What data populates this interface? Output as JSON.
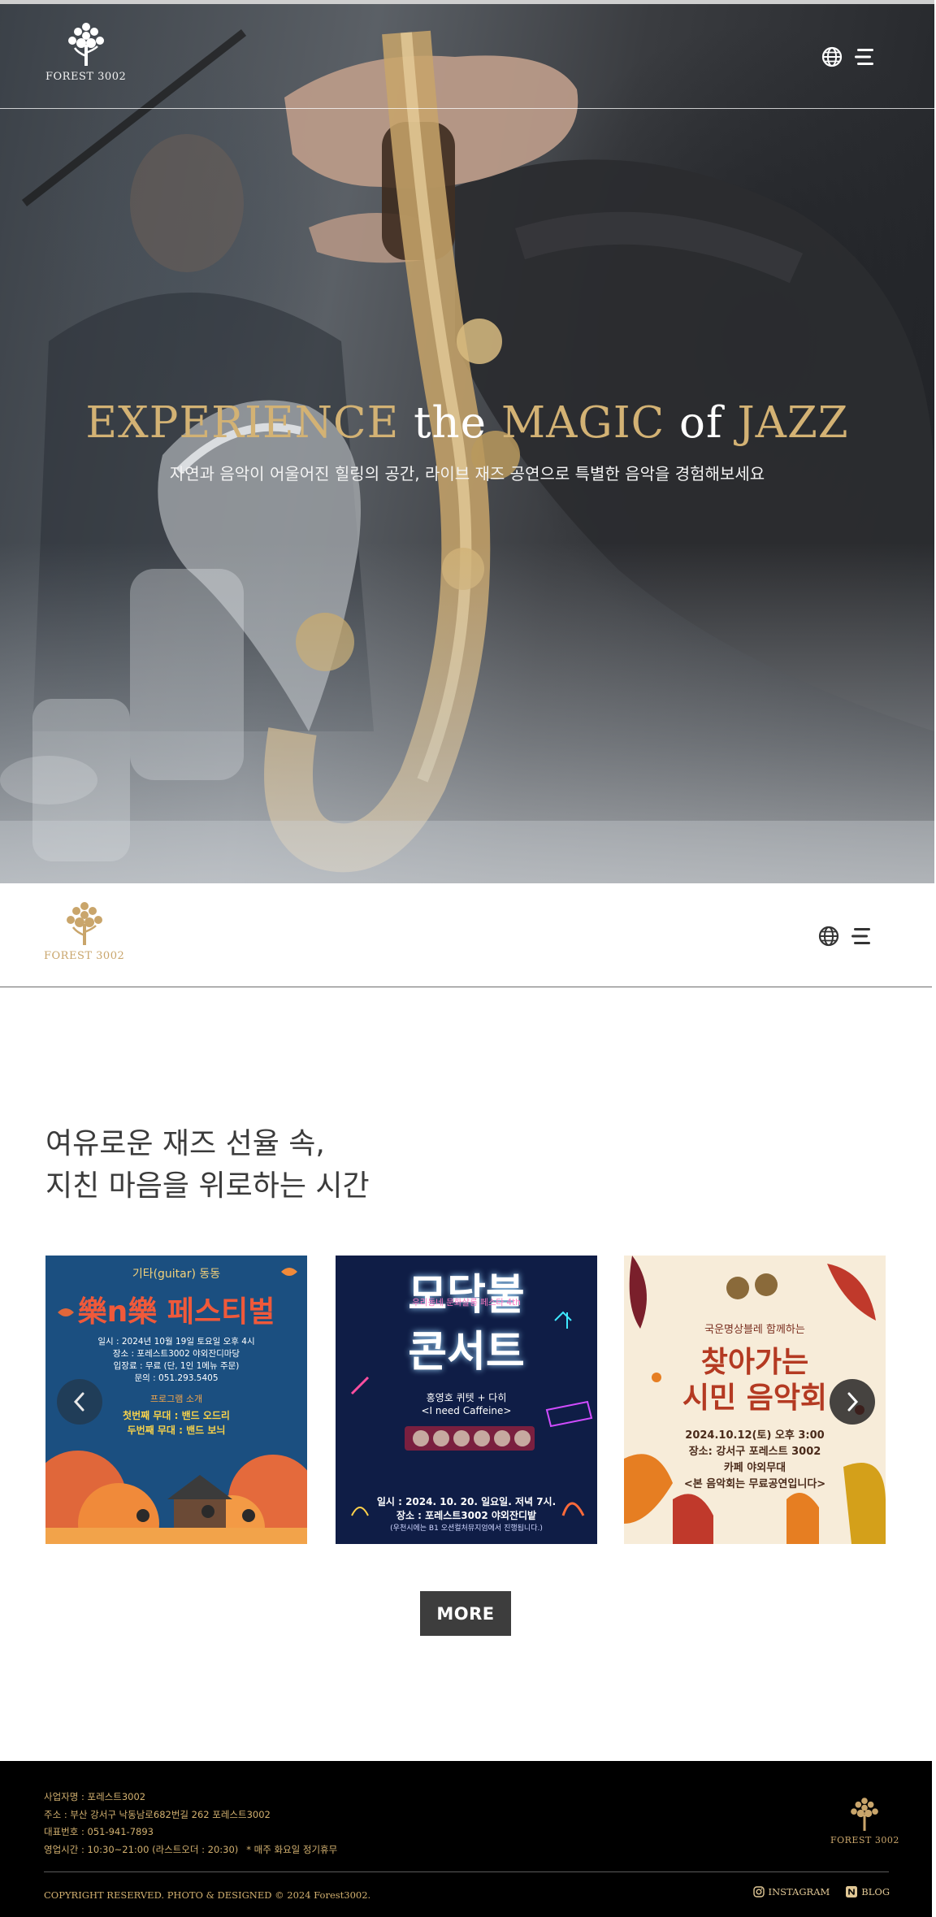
{
  "header": {
    "logo_text": "FOREST 3002",
    "globe_icon": "globe-icon",
    "menu_icon": "hamburger-menu-icon"
  },
  "hero": {
    "title_part1": "EXPERIENCE",
    "title_part2": "the",
    "title_part3": "MAGIC",
    "title_part4": "of",
    "title_part5": "JAZZ",
    "subtitle": "자연과 음악이 어울어진 힐링의 공간, 라이브 재즈 공연으로 특별한 음악을 경험해보세요"
  },
  "main": {
    "headline_line1": "여유로운 재즈 선율 속,",
    "headline_line2": "지친 마음을 위로하는 시간",
    "more_label": "MORE",
    "posters": [
      {
        "kicker": "기타(guitar) 동동",
        "title": "樂n樂 페스티벌",
        "info1": "일시 : 2024년 10월 19일 토요일 오후 4시",
        "info2": "장소 : 포레스트3002 야외잔디마당",
        "info3": "입장료 : 무료 (단, 1인 1메뉴 주문)",
        "info4": "문의 : 051.293.5405",
        "program": "프로그램 소개",
        "stage1": "첫번째 무대 : 밴드 오드리",
        "stage2": "두번째 무대 : 밴드 보늬"
      },
      {
        "kicker": "우리동네 문화살롱 페스타 4th",
        "title_line1": "모닥불",
        "title_line2": "콘서트",
        "performer1": "홍영호 퀴텟 + 다히 ",
        "performer2": "<I need Caffeine>",
        "info1": "일시 : 2024. 10. 20. 일요일. 저녁 7시.",
        "info2": "장소 : 포레스트3002 야외잔디밭",
        "info3": "(우천시에는 B1 오션컬처뮤지엄에서 진행됩니다.)"
      },
      {
        "kicker": "국운명상블레 함께하는",
        "title_line1": "찾아가는",
        "title_line2": "시민 음악회",
        "info1": "2024.10.12(토) 오후 3:00",
        "info2": "장소: 강서구 포레스트 3002",
        "info3": "카페 야외무대",
        "info4": "<본 음악회는 무료공연입니다>"
      }
    ],
    "prev_icon": "chevron-left-icon",
    "next_icon": "chevron-right-icon"
  },
  "footer": {
    "business_name": "사업자명 : 포레스트3002",
    "address": "주소 : 부산 강서구 낙동남로682번길 262 포레스트3002",
    "phone": "대표번호 : 051-941-7893",
    "hours": "영업시간 : 10:30~21:00 (라스트오더 : 20:30)",
    "holiday_note": "* 매주 화요일 정기휴무",
    "copyright": "COPYRIGHT RESERVED. PHOTO & DESIGNED © 2024 Forest3002.",
    "instagram_label": "INSTAGRAM",
    "blog_label": "BLOG",
    "logo_text": "FOREST 3002"
  },
  "colors": {
    "gold": "#d3b274",
    "footer_gold": "#d2b06f",
    "dark_button": "#3d3d3d"
  }
}
